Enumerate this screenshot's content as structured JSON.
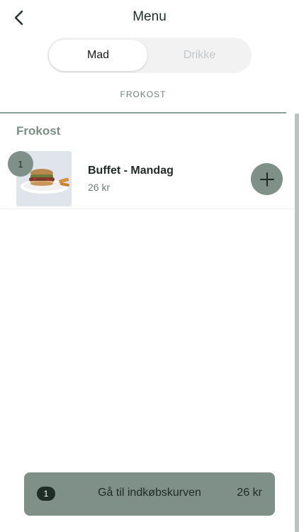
{
  "header": {
    "title": "Menu",
    "back_icon": "chevron-left-icon"
  },
  "segments": {
    "active": "Mad",
    "inactive": "Drikke"
  },
  "category_tab": {
    "label": "FROKOST"
  },
  "section": {
    "title": "Frokost"
  },
  "items": [
    {
      "name": "Buffet - Mandag",
      "price": "26 kr",
      "quantity": "1",
      "image": "sandwich-plate-image",
      "add_icon": "plus-icon"
    }
  ],
  "cart": {
    "count": "1",
    "label": "Gå til indkøbskurven",
    "total": "26 kr"
  },
  "colors": {
    "accent": "#7e9088",
    "text": "#1f2a26",
    "muted": "#6f8179",
    "inactive": "#c3c6c8"
  }
}
